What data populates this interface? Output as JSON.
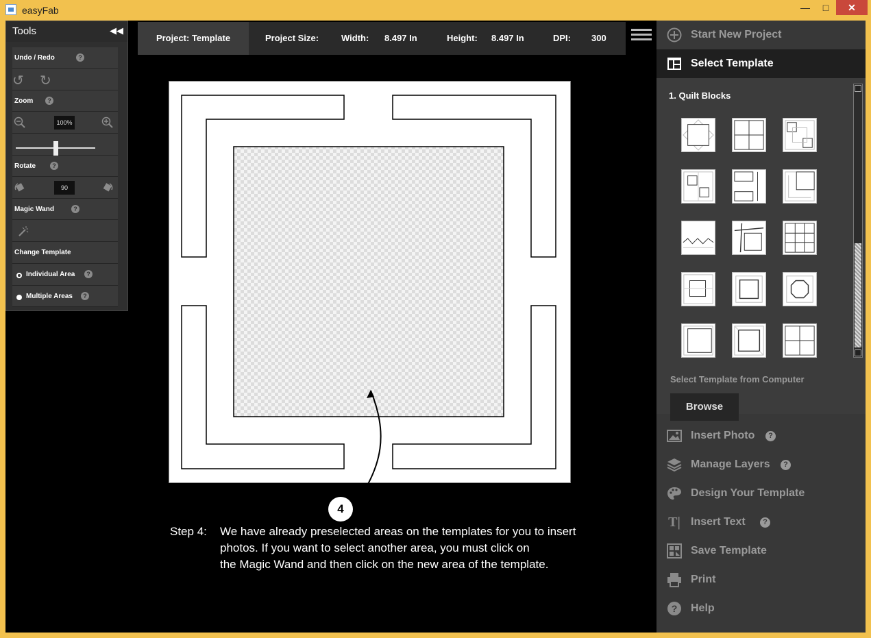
{
  "window": {
    "title": "easyFab",
    "minimize": "—",
    "maximize": "□",
    "close": "✕"
  },
  "tools": {
    "title": "Tools",
    "undo_redo": "Undo / Redo",
    "zoom": "Zoom",
    "zoom_value": "100%",
    "zoom_slider_level": 0.5,
    "rotate": "Rotate",
    "rotate_value": "90",
    "magic_wand": "Magic Wand",
    "change_template": "Change Template",
    "individual_area": "Individual Area",
    "multiple_areas": "Multiple Areas",
    "help": "?"
  },
  "infobar": {
    "project": "Project: Template",
    "size_label": "Project Size:",
    "width_label": "Width:",
    "width_value": "8.497 In",
    "height_label": "Height:",
    "height_value": "8.497 In",
    "dpi_label": "DPI:",
    "dpi_value": "300"
  },
  "annotation": {
    "marker": "4",
    "step_label": "Step 4:",
    "lines": [
      "We have already preselected areas on the templates for you to insert",
      "photos. If you want to select another area, you must click on",
      "the Magic Wand and then click on the new area of the template."
    ]
  },
  "rpanel": {
    "start_new": "Start New Project",
    "select_template": "Select Template",
    "category": "1. Quilt Blocks",
    "from_computer": "Select Template from Computer",
    "browse": "Browse",
    "insert_photo": "Insert Photo",
    "manage_layers": "Manage Layers",
    "design_template": "Design Your Template",
    "insert_text": "Insert Text",
    "save_template": "Save Template",
    "print": "Print",
    "help": "Help"
  }
}
